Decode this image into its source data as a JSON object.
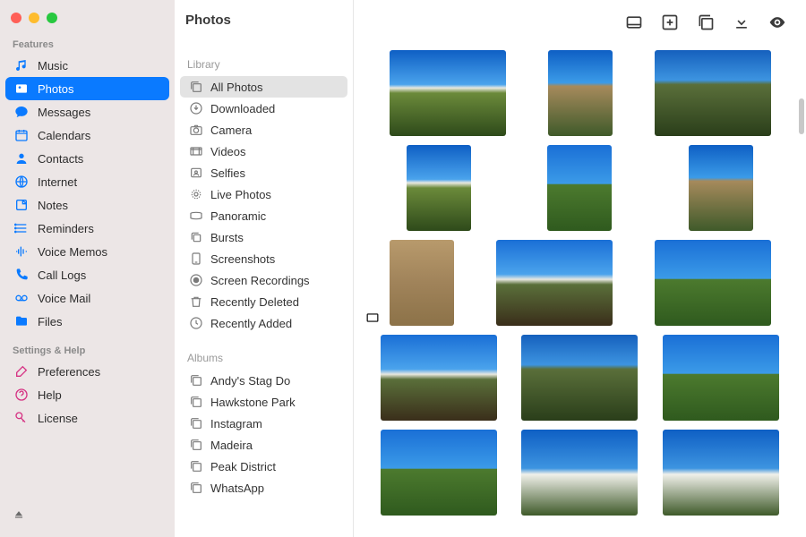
{
  "header": {
    "title": "Photos"
  },
  "sidebar": {
    "features_label": "Features",
    "settings_label": "Settings & Help",
    "items": [
      {
        "label": "Music",
        "icon": "music-icon"
      },
      {
        "label": "Photos",
        "icon": "photos-icon",
        "active": true
      },
      {
        "label": "Messages",
        "icon": "messages-icon"
      },
      {
        "label": "Calendars",
        "icon": "calendars-icon"
      },
      {
        "label": "Contacts",
        "icon": "contacts-icon"
      },
      {
        "label": "Internet",
        "icon": "internet-icon"
      },
      {
        "label": "Notes",
        "icon": "notes-icon"
      },
      {
        "label": "Reminders",
        "icon": "reminders-icon"
      },
      {
        "label": "Voice Memos",
        "icon": "voicememos-icon"
      },
      {
        "label": "Call Logs",
        "icon": "calllogs-icon"
      },
      {
        "label": "Voice Mail",
        "icon": "voicemail-icon"
      },
      {
        "label": "Files",
        "icon": "files-icon"
      }
    ],
    "settings_items": [
      {
        "label": "Preferences",
        "icon": "preferences-icon",
        "color": "#d63384"
      },
      {
        "label": "Help",
        "icon": "help-icon",
        "color": "#d63384"
      },
      {
        "label": "License",
        "icon": "license-icon",
        "color": "#d63384"
      }
    ]
  },
  "library": {
    "library_label": "Library",
    "albums_label": "Albums",
    "items": [
      {
        "label": "All Photos",
        "icon": "stack-icon",
        "active": true
      },
      {
        "label": "Downloaded",
        "icon": "download-icon"
      },
      {
        "label": "Camera",
        "icon": "camera-icon"
      },
      {
        "label": "Videos",
        "icon": "video-icon"
      },
      {
        "label": "Selfies",
        "icon": "selfie-icon"
      },
      {
        "label": "Live Photos",
        "icon": "live-icon"
      },
      {
        "label": "Panoramic",
        "icon": "panoramic-icon"
      },
      {
        "label": "Bursts",
        "icon": "bursts-icon"
      },
      {
        "label": "Screenshots",
        "icon": "screenshot-icon"
      },
      {
        "label": "Screen Recordings",
        "icon": "screenrec-icon"
      },
      {
        "label": "Recently Deleted",
        "icon": "trash-icon"
      },
      {
        "label": "Recently Added",
        "icon": "clock-icon"
      }
    ],
    "albums": [
      {
        "label": "Andy's Stag Do"
      },
      {
        "label": "Hawkstone Park"
      },
      {
        "label": "Instagram"
      },
      {
        "label": "Madeira"
      },
      {
        "label": "Peak District"
      },
      {
        "label": "WhatsApp"
      }
    ]
  },
  "toolbar": {
    "buttons": [
      "panel-icon",
      "add-icon",
      "albums-icon",
      "import-icon",
      "preview-icon"
    ]
  }
}
